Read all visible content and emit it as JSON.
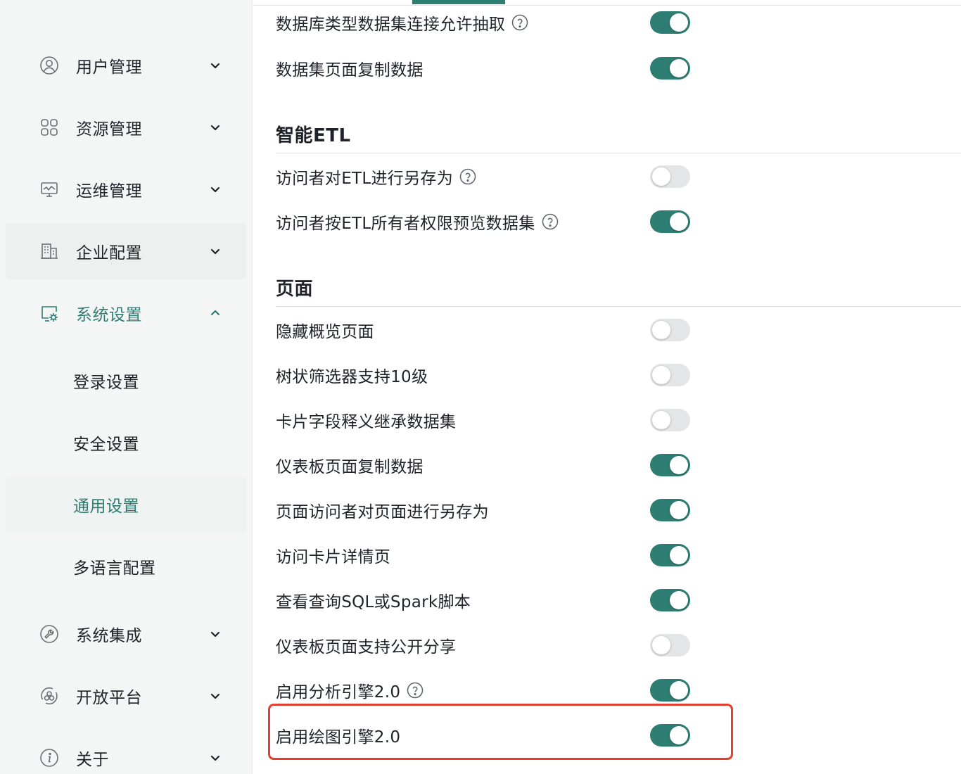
{
  "sidebar": {
    "items": [
      {
        "label": "用户管理",
        "icon": "user-circle-icon",
        "expanded": false
      },
      {
        "label": "资源管理",
        "icon": "grid-icon",
        "expanded": false
      },
      {
        "label": "运维管理",
        "icon": "monitor-icon",
        "expanded": false
      },
      {
        "label": "企业配置",
        "icon": "building-icon",
        "expanded": false
      },
      {
        "label": "系统设置",
        "icon": "settings-monitor-icon",
        "expanded": true
      },
      {
        "label": "系统集成",
        "icon": "wrench-circle-icon",
        "expanded": false
      },
      {
        "label": "开放平台",
        "icon": "platform-icon",
        "expanded": false
      },
      {
        "label": "关于",
        "icon": "info-icon",
        "expanded": false
      }
    ],
    "sub_items": [
      {
        "label": "登录设置",
        "selected": false
      },
      {
        "label": "安全设置",
        "selected": false
      },
      {
        "label": "通用设置",
        "selected": true
      },
      {
        "label": "多语言配置",
        "selected": false
      }
    ]
  },
  "main": {
    "top_rows": [
      {
        "label": "数据库类型数据集连接允许抽取",
        "help": true,
        "enabled": true
      },
      {
        "label": "数据集页面复制数据",
        "help": false,
        "enabled": true
      }
    ],
    "sections": [
      {
        "title": "智能ETL",
        "rows": [
          {
            "label": "访问者对ETL进行另存为",
            "help": true,
            "enabled": false
          },
          {
            "label": "访问者按ETL所有者权限预览数据集",
            "help": true,
            "enabled": true
          }
        ]
      },
      {
        "title": "页面",
        "rows": [
          {
            "label": "隐藏概览页面",
            "help": false,
            "enabled": false
          },
          {
            "label": "树状筛选器支持10级",
            "help": false,
            "enabled": false
          },
          {
            "label": "卡片字段释义继承数据集",
            "help": false,
            "enabled": false
          },
          {
            "label": "仪表板页面复制数据",
            "help": false,
            "enabled": true
          },
          {
            "label": "页面访问者对页面进行另存为",
            "help": false,
            "enabled": true
          },
          {
            "label": "访问卡片详情页",
            "help": false,
            "enabled": true
          },
          {
            "label": "查看查询SQL或Spark脚本",
            "help": false,
            "enabled": true
          },
          {
            "label": "仪表板页面支持公开分享",
            "help": false,
            "enabled": false
          },
          {
            "label": "启用分析引擎2.0",
            "help": true,
            "enabled": true
          },
          {
            "label": "启用绘图引擎2.0",
            "help": false,
            "enabled": true
          }
        ]
      }
    ]
  },
  "colors": {
    "accent": "#2e7d73",
    "highlight": "#e0402d",
    "toggle_off": "#e3e5e7"
  }
}
